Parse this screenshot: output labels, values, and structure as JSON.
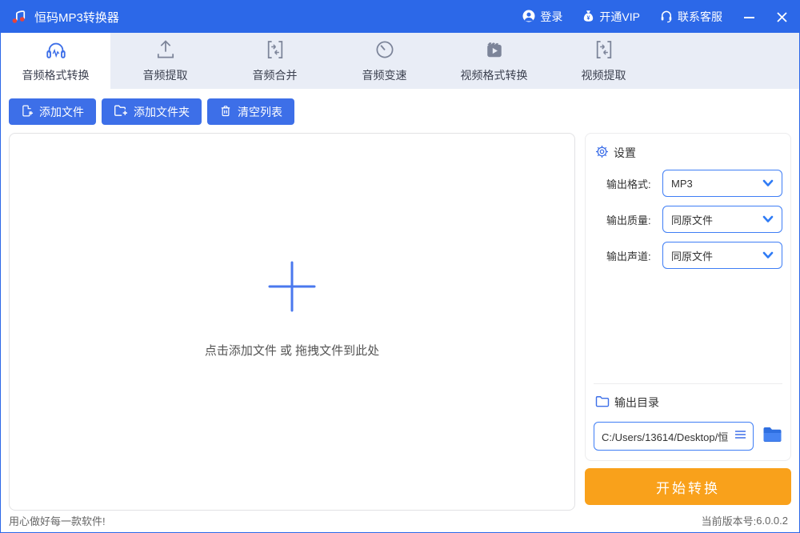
{
  "window": {
    "title": "恒码MP3转换器",
    "actions": {
      "login": "登录",
      "vip": "开通VIP",
      "support": "联系客服"
    }
  },
  "tabs": [
    {
      "label": "音频格式转换",
      "icon": "headphones-icon",
      "active": true
    },
    {
      "label": "音频提取",
      "icon": "upload-icon",
      "active": false
    },
    {
      "label": "音频合并",
      "icon": "merge-icon",
      "active": false
    },
    {
      "label": "音频变速",
      "icon": "speed-gauge-icon",
      "active": false
    },
    {
      "label": "视频格式转换",
      "icon": "video-icon",
      "active": false
    },
    {
      "label": "视频提取",
      "icon": "extract-icon",
      "active": false
    }
  ],
  "toolbar": {
    "add_file": "添加文件",
    "add_folder": "添加文件夹",
    "clear_list": "清空列表"
  },
  "dropzone": {
    "hint": "点击添加文件 或 拖拽文件到此处"
  },
  "settings": {
    "title": "设置",
    "fields": [
      {
        "label": "输出格式:",
        "value": "MP3"
      },
      {
        "label": "输出质量:",
        "value": "同原文件"
      },
      {
        "label": "输出声道:",
        "value": "同原文件"
      }
    ],
    "output_dir": {
      "title": "输出目录",
      "path": "C:/Users/13614/Desktop/恒"
    }
  },
  "convert_button": "开始转换",
  "statusbar": {
    "slogan": "用心做好每一款软件!",
    "version_label": "当前版本号: ",
    "version": "6.0.0.2"
  },
  "icons": {
    "logo": "music-notes-icon",
    "titlebar": [
      "user-icon",
      "moneybag-icon",
      "headset-icon",
      "minimize-icon",
      "close-icon"
    ],
    "toolbar": [
      "file-plus-icon",
      "folder-plus-icon",
      "trash-icon"
    ],
    "settings": [
      "gear-icon",
      "chevron-down-icon",
      "folder-outline-icon",
      "hamburger-icon",
      "folder-filled-icon"
    ],
    "dropzone": "plus-icon"
  },
  "colors": {
    "titlebar": "#2c68e8",
    "button_blue": "#3d6fe8",
    "tabbar_bg": "#e9edf6",
    "select_border": "#3f7ef5",
    "convert_orange": "#f9a11b",
    "note_red": "#e8443a"
  }
}
